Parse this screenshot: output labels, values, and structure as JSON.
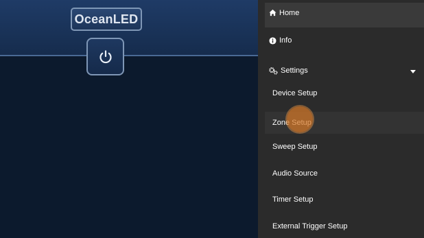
{
  "brand": {
    "logo_text": "OceanLED"
  },
  "controls": {
    "power_icon": "power-icon"
  },
  "menu": {
    "home": "Home",
    "info": "Info",
    "settings": "Settings",
    "settings_expanded": true,
    "subitems": {
      "device_setup": "Device Setup",
      "zone_setup": "Zone Setup",
      "sweep_setup": "Sweep Setup",
      "audio_source": "Audio Source",
      "timer_setup": "Timer Setup",
      "external_trigger_setup": "External Trigger Setup"
    },
    "icons": {
      "home": "home-icon",
      "info": "info-icon",
      "settings": "gears-icon",
      "caret": "caret-down-icon"
    }
  },
  "colors": {
    "header_blue": "#1f3b66",
    "body_navy": "#0c1a2d",
    "menu_bg": "#2b2b2b",
    "tap_indicator": "#d67828"
  }
}
